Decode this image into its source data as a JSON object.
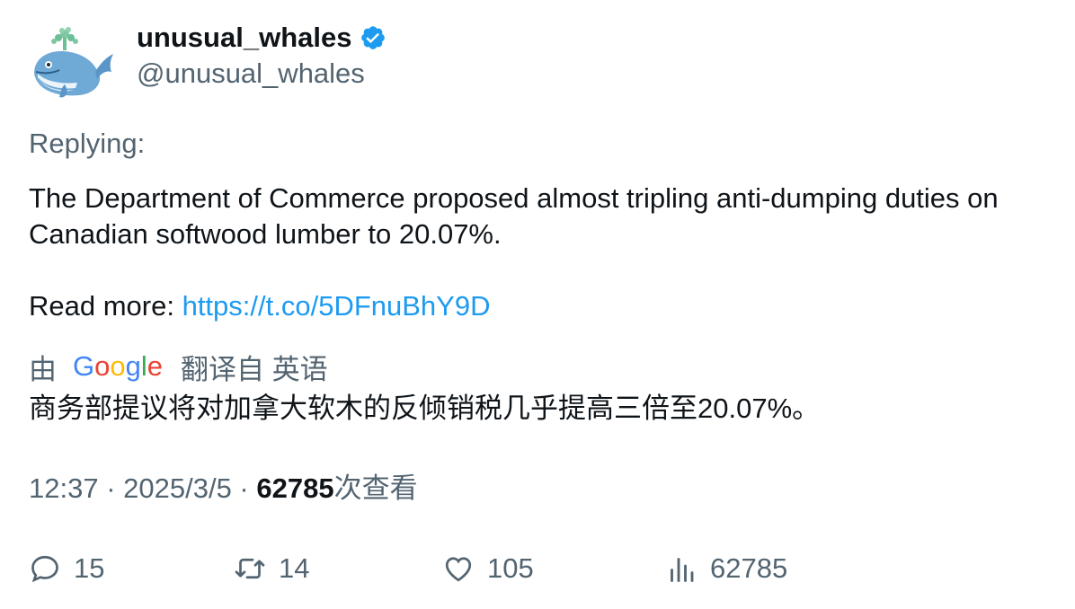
{
  "author": {
    "display_name": "unusual_whales",
    "handle": "@unusual_whales",
    "avatar_icon": "whale-icon",
    "verified_icon": "verified-badge-icon"
  },
  "tweet": {
    "replying_label": "Replying:",
    "text_line": "The Department of Commerce proposed almost tripling anti-dumping duties on Canadian softwood lumber to 20.07%.",
    "read_more_label": "Read more: ",
    "link": "https://t.co/5DFnuBhY9D"
  },
  "translation": {
    "prefix": "由",
    "provider": "Google",
    "suffix": "翻译自 英语",
    "text": "商务部提议将对加拿大软木的反倾销税几乎提高三倍至20.07%。"
  },
  "meta": {
    "time": "12:37",
    "separator": " · ",
    "date": "2025/3/5",
    "views": "62785",
    "views_label": "次查看"
  },
  "actions": {
    "replies": "15",
    "retweets": "14",
    "likes": "105",
    "views": "62785"
  },
  "colors": {
    "text": "#0f1419",
    "secondary": "#536471",
    "link": "#1d9bf0",
    "verified": "#1d9bf0"
  }
}
